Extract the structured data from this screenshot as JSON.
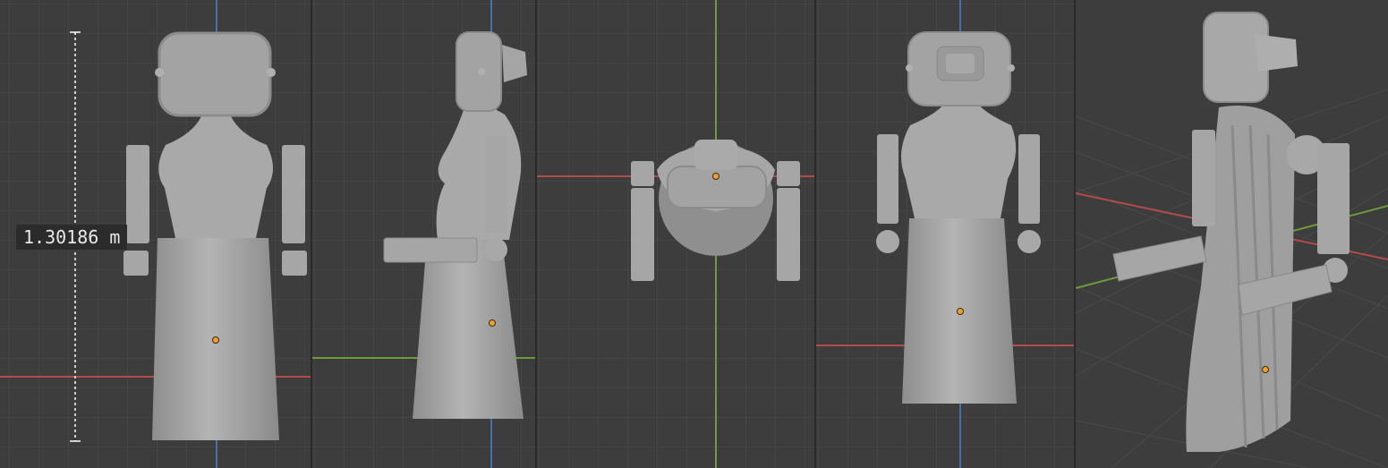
{
  "window": {
    "title": ""
  },
  "viewports": [
    {
      "id": "front",
      "view": "front-orthographic"
    },
    {
      "id": "right",
      "view": "right-orthographic"
    },
    {
      "id": "top",
      "view": "top-orthographic"
    },
    {
      "id": "back",
      "view": "back-orthographic"
    },
    {
      "id": "perspective",
      "view": "user-perspective"
    }
  ],
  "measure": {
    "label": "1.30186 m"
  },
  "colors": {
    "background": "#3d3d3d",
    "grid": "#4a4a4a",
    "axis_x": "#b34b4b",
    "axis_y": "#6f9a3b",
    "axis_z": "#4a6fa5",
    "model": "#a6a6a6",
    "model_shade": "#8a8a8a",
    "origin_dot": "#f0a030"
  },
  "icons": [
    "origin-dot-icon",
    "ruler-icon"
  ]
}
